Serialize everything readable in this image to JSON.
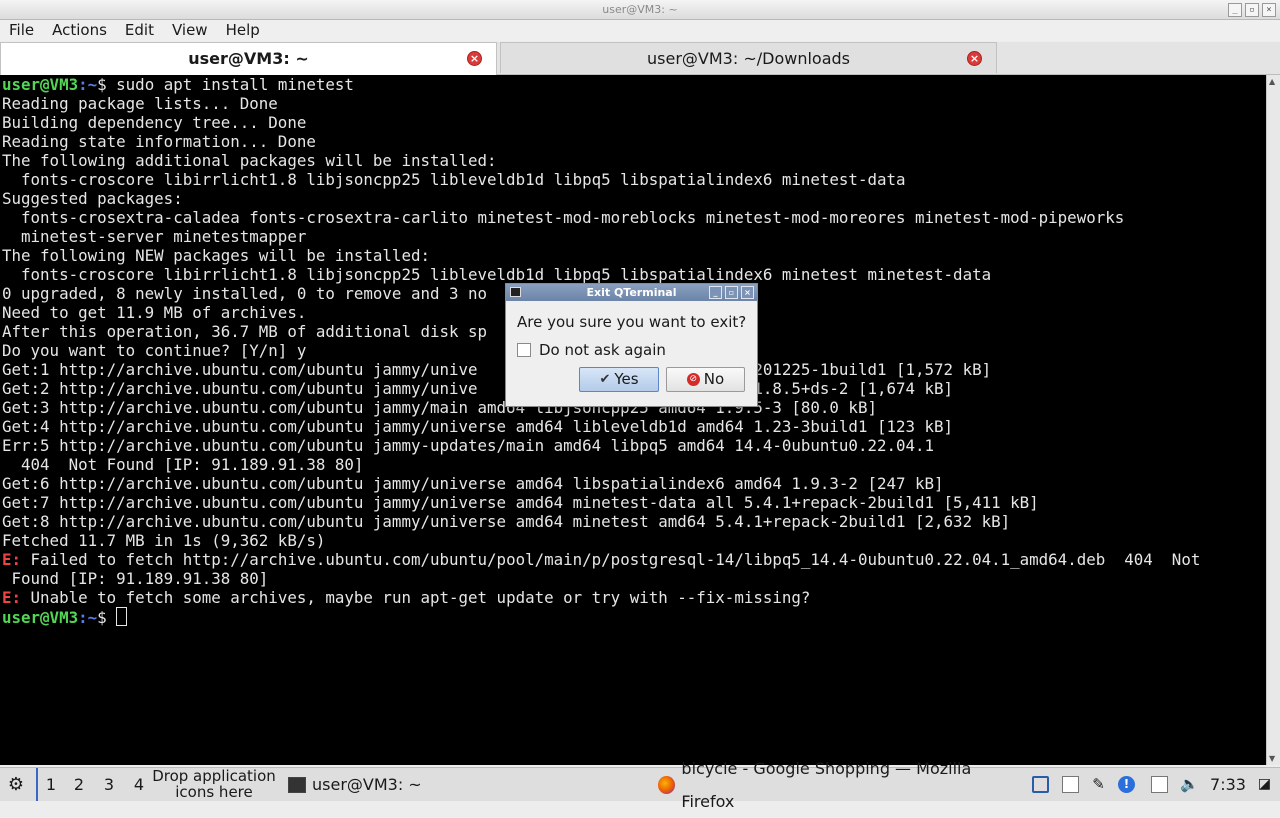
{
  "window": {
    "title": "user@VM3: ~",
    "buttons": [
      "_",
      "▫",
      "×"
    ]
  },
  "menu": [
    "File",
    "Actions",
    "Edit",
    "View",
    "Help"
  ],
  "tabs": [
    {
      "label": "user@VM3: ~",
      "active": true
    },
    {
      "label": "user@VM3: ~/Downloads",
      "active": false
    }
  ],
  "terminal": {
    "lines": [
      {
        "type": "prompt",
        "user": "user@VM3",
        "path": ":~",
        "sym": "$ ",
        "cmd": "sudo apt install minetest"
      },
      {
        "type": "text",
        "text": "Reading package lists... Done"
      },
      {
        "type": "text",
        "text": "Building dependency tree... Done"
      },
      {
        "type": "text",
        "text": "Reading state information... Done"
      },
      {
        "type": "text",
        "text": "The following additional packages will be installed:"
      },
      {
        "type": "text",
        "text": "  fonts-croscore libirrlicht1.8 libjsoncpp25 libleveldb1d libpq5 libspatialindex6 minetest-data"
      },
      {
        "type": "text",
        "text": "Suggested packages:"
      },
      {
        "type": "text",
        "text": "  fonts-crosextra-caladea fonts-crosextra-carlito minetest-mod-moreblocks minetest-mod-moreores minetest-mod-pipeworks"
      },
      {
        "type": "text",
        "text": "  minetest-server minetestmapper"
      },
      {
        "type": "text",
        "text": "The following NEW packages will be installed:"
      },
      {
        "type": "text",
        "text": "  fonts-croscore libirrlicht1.8 libjsoncpp25 libleveldb1d libpq5 libspatialindex6 minetest minetest-data"
      },
      {
        "type": "text",
        "text": "0 upgraded, 8 newly installed, 0 to remove and 3 no"
      },
      {
        "type": "text",
        "text": "Need to get 11.9 MB of archives."
      },
      {
        "type": "text",
        "text": "After this operation, 36.7 MB of additional disk sp"
      },
      {
        "type": "text",
        "text": "Do you want to continue? [Y/n] y"
      },
      {
        "type": "text",
        "text": "Get:1 http://archive.ubuntu.com/ubuntu jammy/unive                       all 20201225-1build1 [1,572 kB]"
      },
      {
        "type": "text",
        "text": "Get:2 http://archive.ubuntu.com/ubuntu jammy/unive                       amd64 1.8.5+ds-2 [1,674 kB]"
      },
      {
        "type": "text",
        "text": "Get:3 http://archive.ubuntu.com/ubuntu jammy/main amd64 libjsoncpp25 amd64 1.9.5-3 [80.0 kB]"
      },
      {
        "type": "text",
        "text": "Get:4 http://archive.ubuntu.com/ubuntu jammy/universe amd64 libleveldb1d amd64 1.23-3build1 [123 kB]"
      },
      {
        "type": "text",
        "text": "Err:5 http://archive.ubuntu.com/ubuntu jammy-updates/main amd64 libpq5 amd64 14.4-0ubuntu0.22.04.1"
      },
      {
        "type": "text",
        "text": "  404  Not Found [IP: 91.189.91.38 80]"
      },
      {
        "type": "text",
        "text": "Get:6 http://archive.ubuntu.com/ubuntu jammy/universe amd64 libspatialindex6 amd64 1.9.3-2 [247 kB]"
      },
      {
        "type": "text",
        "text": "Get:7 http://archive.ubuntu.com/ubuntu jammy/universe amd64 minetest-data all 5.4.1+repack-2build1 [5,411 kB]"
      },
      {
        "type": "text",
        "text": "Get:8 http://archive.ubuntu.com/ubuntu jammy/universe amd64 minetest amd64 5.4.1+repack-2build1 [2,632 kB]"
      },
      {
        "type": "text",
        "text": "Fetched 11.7 MB in 1s (9,362 kB/s)"
      },
      {
        "type": "error",
        "tag": "E:",
        "text": " Failed to fetch http://archive.ubuntu.com/ubuntu/pool/main/p/postgresql-14/libpq5_14.4-0ubuntu0.22.04.1_amd64.deb  404  Not"
      },
      {
        "type": "text",
        "text": " Found [IP: 91.189.91.38 80]"
      },
      {
        "type": "error",
        "tag": "E:",
        "text": " Unable to fetch some archives, maybe run apt-get update or try with --fix-missing?"
      },
      {
        "type": "prompt",
        "user": "user@VM3",
        "path": ":~",
        "sym": "$ ",
        "cmd": "",
        "cursor": true
      }
    ]
  },
  "dialog": {
    "title": "Exit QTerminal",
    "question": "Are you sure you want to exit?",
    "checkbox_label": "Do not ask again",
    "checkbox_checked": false,
    "yes_label": "Yes",
    "no_label": "No"
  },
  "taskbar": {
    "workspaces": [
      "1",
      "2",
      "3",
      "4"
    ],
    "active_workspace": "1",
    "drop_text": "Drop application icons here",
    "tasks": [
      {
        "label": "user@VM3: ~",
        "icon": "terminal-icon"
      },
      {
        "label": "bicycle - Google Shopping — Mozilla Firefox",
        "icon": "firefox-icon"
      }
    ],
    "tray_icons": [
      "network-icon",
      "clipboard-icon",
      "tools-icon",
      "info-icon",
      "notes-icon",
      "volume-icon"
    ],
    "clock": "7:33"
  }
}
